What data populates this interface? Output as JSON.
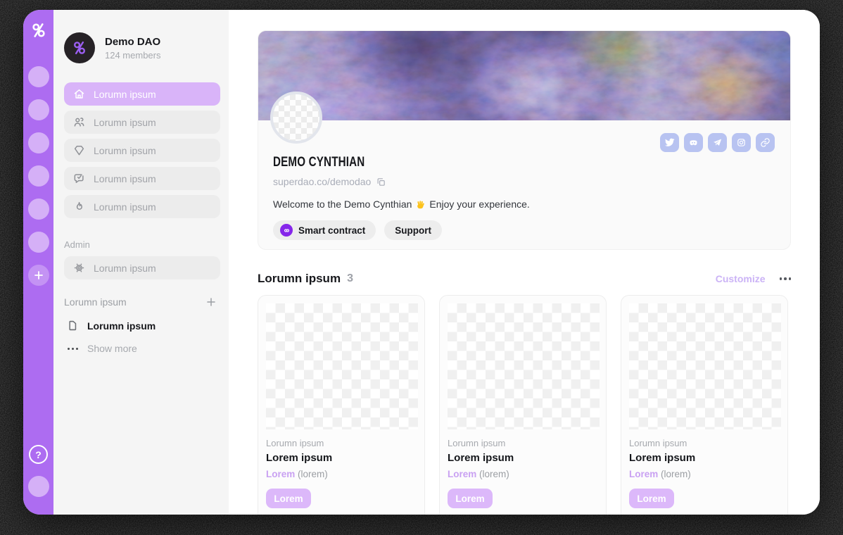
{
  "rail": {
    "logo_icon": "superdao-logo",
    "placeholder_count": 6,
    "help_label": "?"
  },
  "sidebar": {
    "dao": {
      "name": "Demo DAO",
      "members": "124 members"
    },
    "nav": [
      {
        "label": "Lorumn ipsum",
        "icon": "home",
        "active": true
      },
      {
        "label": "Lorumn ipsum",
        "icon": "members",
        "active": false
      },
      {
        "label": "Lorumn ipsum",
        "icon": "treasury-gem",
        "active": false
      },
      {
        "label": "Lorumn ipsum",
        "icon": "voting-chat-check",
        "active": false
      },
      {
        "label": "Lorumn ipsum",
        "icon": "activity-flame",
        "active": false
      }
    ],
    "admin": {
      "section_label": "Admin",
      "item": {
        "label": "Lorumn ipsum",
        "icon": "gear"
      }
    },
    "pages": {
      "header": "Lorumn ipsum",
      "items": [
        {
          "label": "Lorumn ipsum",
          "icon": "document"
        }
      ],
      "show_more_label": "Show more"
    }
  },
  "profile": {
    "title": "DEMO CYNTHIAN",
    "url": "superdao.co/demodao",
    "welcome_before": "Welcome to the Demo Cynthian",
    "welcome_emoji": "👋",
    "welcome_after": "Enjoy your experience.",
    "actions": [
      {
        "label": "Smart contract",
        "icon": "contract-link"
      },
      {
        "label": "Support"
      }
    ],
    "socials": [
      "twitter",
      "discord",
      "telegram",
      "instagram",
      "link"
    ]
  },
  "section": {
    "title": "Lorumn ipsum",
    "count": "3",
    "customize_label": "Customize"
  },
  "cards": [
    {
      "overline": "Lorumn ipsum",
      "title": "Lorem ipsum",
      "link": "Lorem",
      "link_note": "(lorem)",
      "button": "Lorem"
    },
    {
      "overline": "Lorumn ipsum",
      "title": "Lorem ipsum",
      "link": "Lorem",
      "link_note": "(lorem)",
      "button": "Lorem"
    },
    {
      "overline": "Lorumn ipsum",
      "title": "Lorem ipsum",
      "link": "Lorem",
      "link_note": "(lorem)",
      "button": "Lorem"
    }
  ],
  "colors": {
    "rail_purple": "#ad6cf1",
    "rail_circle": "#d5b0f7",
    "active_nav": "#d9b4f9",
    "accent_purple": "#8526ea",
    "social_tile": "#b8c3f1",
    "customize_link": "#cbb3f6",
    "card_button": "#dcb8fa",
    "sidebar_bg": "#f5f5f5",
    "item_bg": "#ececec"
  }
}
